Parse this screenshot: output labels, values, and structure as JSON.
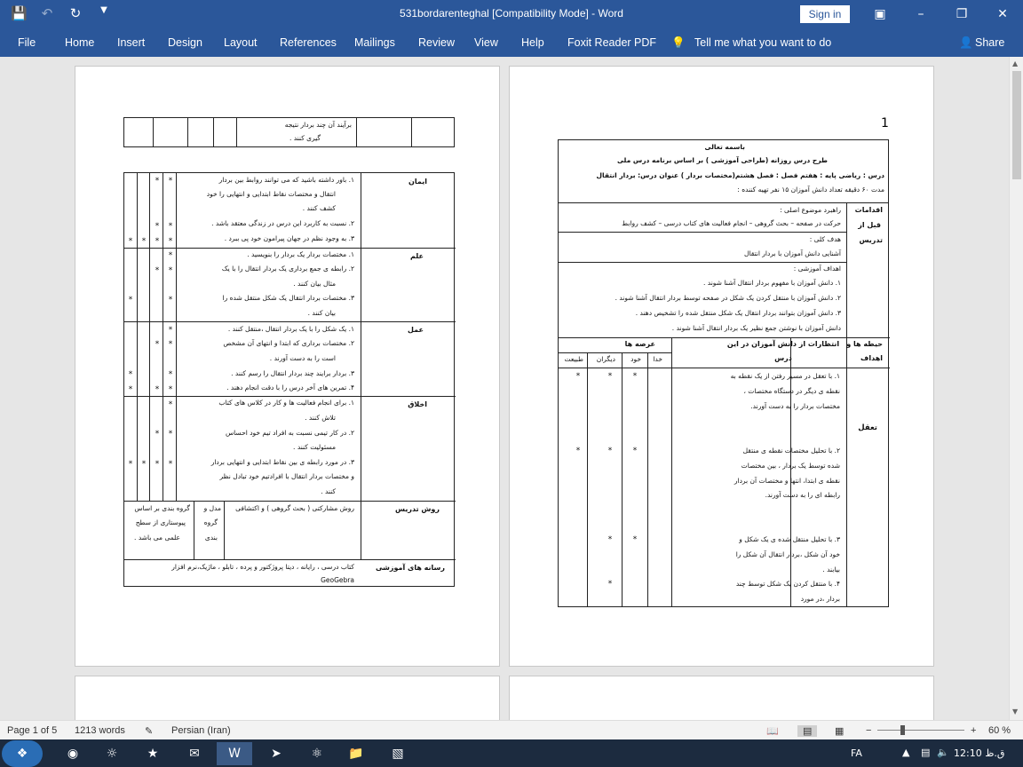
{
  "window": {
    "title": "531bordarenteghal [Compatibility Mode]  -  Word",
    "signin": "Sign in"
  },
  "qat": {
    "save_icon": "save-icon",
    "undo_icon": "undo-icon",
    "redo_icon": "redo-icon",
    "customize_icon": "customize-icon"
  },
  "ribbon": {
    "tabs": [
      "File",
      "Home",
      "Insert",
      "Design",
      "Layout",
      "References",
      "Mailings",
      "Review",
      "View",
      "Help",
      "Foxit Reader PDF"
    ],
    "tell": "Tell me what you want to do",
    "share": "Share"
  },
  "status": {
    "page": "Page 1 of 5",
    "words": "1213 words",
    "language": "Persian (Iran)",
    "zoom": "60 %",
    "minus": "−",
    "plus": "+"
  },
  "taskbar": {
    "lang": "FA",
    "time": "12:10 ق.ظ"
  },
  "right_page": {
    "page_number": "1",
    "header": {
      "line1": "باسمه تعالی",
      "line2": "طرح درس روزانه (طراحی آموزشی ) بر اساس برنامه درس ملی",
      "line3": "درس : ریاضی       پایه : هفتم      فصل : فصل هشتم(مختصات بردار )    عنوان درس: بردار انتقال",
      "line4": "مدت ۶۰ دقیقه          تعداد دانش آموزان ۱۵ نفر                    تهیه کننده :"
    },
    "side_label": [
      "اقدامات",
      "قبل از",
      "تدریس"
    ],
    "rahbord_title": "راهبرد موضوع اصلی :",
    "rahbord": "حرکت در صفحه – بحث گروهی – انجام فعالیت های کتاب درسی – کشف روابط",
    "hadaf_koli_title": "هدف کلی :",
    "hadaf_koli": "آشنایی دانش آموزان با بردار انتقال",
    "ahdaf_title": "اهداف آموزشی :",
    "ahdaf": [
      "۱.  دانش آموزان با مفهوم بردار انتقال آشنا شوند .",
      "۲.  دانش آموزان با منتقل کردن یک شکل در صفحه توسط بردار انتقال آشنا شوند .",
      "۳.  دانش آموزان بتوانند بردار انتقال یک شکل منتقل شده را تشخیص دهند .",
      "دانش آموزان با نوشتن جمع نظیر یک بردار انتقال آشنا شوند ."
    ],
    "col_hiteh": "حیطه ها و اهداف",
    "col_entezarat": "انتظارات از دانش آموزان در این درس",
    "col_arseh": "عرصه ها",
    "arseh": [
      "خدا",
      "خود",
      "دیگران",
      "طبیعت"
    ],
    "taaghol": "تعقل",
    "items": [
      "۱.  با تعقل در مسیر رفتن از یک نقطه به نقطه ی دیگر در دستگاه مختصات ، مختصات بردار را به دست آورند.",
      "۲.  با تحلیل مختصات نقطه ی منتقل شده توسط یک بردار ، بین مختصات نقطه ی ابتدا، انتها و مختصات آن بردار رابطه ای را به دست آورند.",
      "۳.  با تحلیل منتقل شده ی یک شکل و خود آن شکل ،بردار انتقال آن شکل را بیابند .",
      "۴.  با منتقل کردن یک شکل توسط چند بردار ،در مورد"
    ],
    "star": "*"
  },
  "left_page": {
    "top_row": [
      "برآیند آن چند بردار نتیجه",
      "گیری کنند ."
    ],
    "sections": [
      {
        "title": "ایمان",
        "lines": [
          "۱.  باور داشته باشید که می توانند روابط بین بردار",
          "انتقال و مختصات نقاط ابتدایی و انتهایی را خود",
          "کشف کنند .",
          "۲.  نسبت به کاربرد این درس در زندگی معتقد باشد .",
          "۳.  به وجود نظم در جهان پیرامون خود پی ببرد ."
        ]
      },
      {
        "title": "علم",
        "lines": [
          "۱.  مختصات بردار یک بردار را بنویسید .",
          "۲.  رابطه ی جمع برداری یک بردار انتقال را با یک",
          "مثال بیان کنند .",
          "۳.  مختصات بردار انتقال یک شکل منتقل شده را",
          "بیان کنند ."
        ]
      },
      {
        "title": "عمل",
        "lines": [
          "۱.  یک شکل را با یک بردار انتقال ،منتقل کنند .",
          "۲.  مختصات برداری که ابتدا و انتهای آن مشخص",
          "است را به دست آورند .",
          "۳.  بردار برایند چند بردار انتقال را رسم کنند .",
          "۴.  تمرین های آخر درس را با دقت انجام دهند ."
        ]
      },
      {
        "title": "اخلاق",
        "lines": [
          "۱.  برای انجام فعالیت ها و کار در کلاس های کتاب",
          "تلاش کنند .",
          "۲.  در کار تیمی نسبت به افراد تیم خود احساس",
          "مسئولیت کنند .",
          "۳.  در مورد رابطه ی بین نقاط ابتدایی و انتهایی بردار",
          "و مختصات بردار انتقال با افرادتیم خود تبادل نظر",
          "کنند ."
        ]
      }
    ],
    "ravesh_title": "روش تدریس",
    "ravesh": "روش مشارکتی ( بحث گروهی ) و اکتشافی",
    "model": [
      "مدل و",
      "گروه",
      "بندی"
    ],
    "grouping": [
      "گروه بندی بر اساس",
      "پیوستاری از سطح",
      "علمی می باشد ."
    ],
    "resaneh_title": "رسانه های آموزشی",
    "resaneh": [
      "کتاب درسی ، رایانه ، دیتا پروژکتور و پرده ، تابلو ، ماژیک،نرم افزار",
      "GeoGebra"
    ]
  }
}
